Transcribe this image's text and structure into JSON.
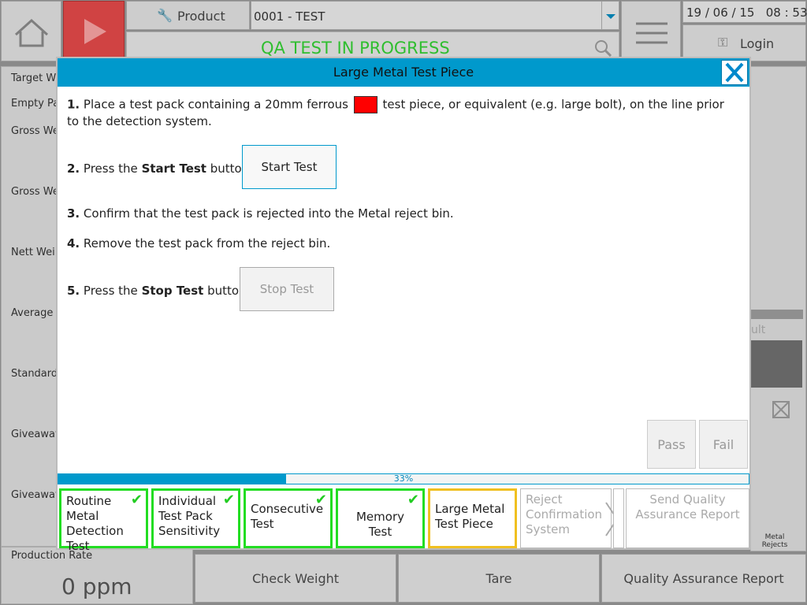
{
  "topbar": {
    "product_label": "Product",
    "product_value": "0001 - TEST",
    "status": "QA TEST IN PROGRESS",
    "datetime": "19 / 06 / 15   08 : 53",
    "login_label": "Login"
  },
  "left_panel": {
    "items": [
      "Target W",
      "Empty Pa",
      "Gross We",
      "Gross We",
      "Nett Wei",
      "Average W",
      "Standard",
      "Giveaway",
      "Giveaway"
    ],
    "production_rate_label": "Production Rate",
    "production_rate_value": "0 ppm"
  },
  "right_panel": {
    "result_fragment": "ult",
    "metal_rejects_label": "Metal\nRejects"
  },
  "modal": {
    "title": "Large Metal Test Piece",
    "step1_num": "1.",
    "step1_text_a": "Place a test pack containing a 20mm ferrous",
    "step1_text_b": "test piece, or equivalent (e.g. large bolt), on the line prior to the detection system.",
    "step2_num": "2.",
    "step2_text_a": "Press the",
    "step2_bold": "Start Test",
    "step2_text_b": "button.",
    "start_test_label": "Start Test",
    "step3_num": "3.",
    "step3_text": "Confirm that the test pack is rejected into the Metal reject bin.",
    "step4_num": "4.",
    "step4_text": "Remove the test pack from the reject bin.",
    "step5_num": "5.",
    "step5_text_a": "Press the",
    "step5_bold": "Stop Test",
    "step5_text_b": "button.",
    "stop_test_label": "Stop Test",
    "pass_label": "Pass",
    "fail_label": "Fail",
    "progress_percent": 33,
    "progress_text": "33%",
    "ferrous_swatch_color": "#ff0000"
  },
  "tests": [
    {
      "label": "Routine Metal Detection Test",
      "state": "done"
    },
    {
      "label": "Individual Test Pack Sensitivity",
      "state": "done"
    },
    {
      "label": "Consecutive Test",
      "state": "done"
    },
    {
      "label": "Memory Test",
      "state": "done"
    },
    {
      "label": "Large Metal Test Piece",
      "state": "active"
    },
    {
      "label": "Reject Confirmation System",
      "state": "pending"
    },
    {
      "label": "Send Quality Assurance Report",
      "state": "pending"
    }
  ],
  "bottom_buttons": [
    "Check Weight",
    "Tare",
    "Quality Assurance Report"
  ],
  "colors": {
    "accent": "#0099cc",
    "status_green": "#33cc33",
    "done_green": "#22dd22",
    "active_yellow": "#f0c020",
    "play_red": "#e04040"
  }
}
